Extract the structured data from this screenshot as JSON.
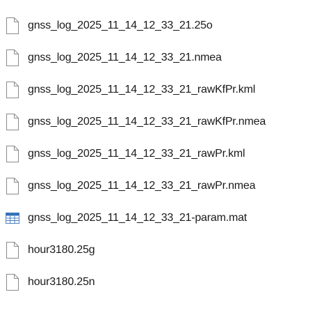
{
  "files": [
    {
      "name": "gnss_log_2025_11_14_12_33_21.25o",
      "icon": "blank-file-icon"
    },
    {
      "name": "gnss_log_2025_11_14_12_33_21.nmea",
      "icon": "blank-file-icon"
    },
    {
      "name": "gnss_log_2025_11_14_12_33_21_rawKfPr.kml",
      "icon": "blank-file-icon"
    },
    {
      "name": "gnss_log_2025_11_14_12_33_21_rawKfPr.nmea",
      "icon": "blank-file-icon"
    },
    {
      "name": "gnss_log_2025_11_14_12_33_21_rawPr.kml",
      "icon": "blank-file-icon"
    },
    {
      "name": "gnss_log_2025_11_14_12_33_21_rawPr.nmea",
      "icon": "blank-file-icon"
    },
    {
      "name": "gnss_log_2025_11_14_12_33_21-param.mat",
      "icon": "table-file-icon"
    },
    {
      "name": "hour3180.25g",
      "icon": "blank-file-icon"
    },
    {
      "name": "hour3180.25n",
      "icon": "blank-file-icon"
    }
  ],
  "colors": {
    "icon_outline": "#8a8a8a",
    "table_blue": "#4a7fc1",
    "table_header": "#2f6bb5",
    "text": "#1a1a1a"
  }
}
